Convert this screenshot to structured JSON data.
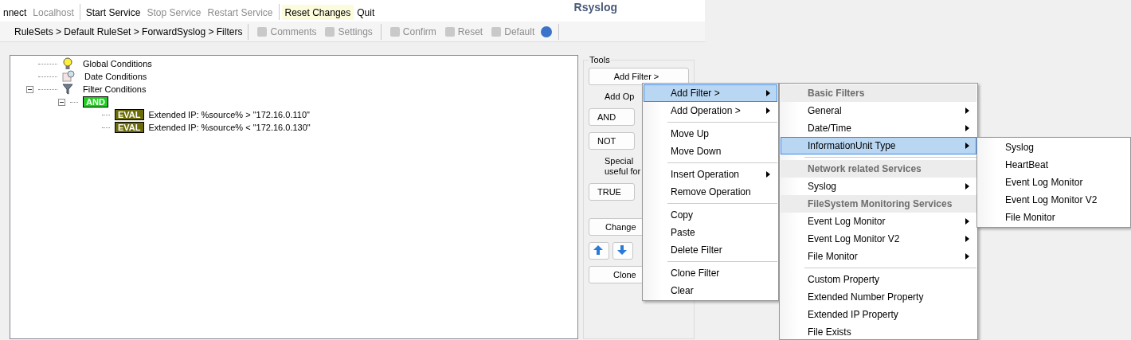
{
  "toolbar": [
    {
      "label": "nnect",
      "disabled": false
    },
    {
      "label": "Localhost",
      "disabled": true
    },
    {
      "label": "Start Service",
      "disabled": false
    },
    {
      "label": "Stop Service",
      "disabled": true
    },
    {
      "label": "Restart Service",
      "disabled": true
    },
    {
      "label": "Reset Changes",
      "disabled": false,
      "selected": true
    },
    {
      "label": "Quit",
      "disabled": false
    }
  ],
  "app_title": "Rsyslog",
  "breadcrumb": "RuleSets > Default RuleSet > ForwardSyslog > Filters",
  "actions": [
    {
      "label": "Comments",
      "disabled": true
    },
    {
      "label": "Settings",
      "disabled": true
    },
    {
      "label": "Confirm",
      "disabled": true
    },
    {
      "label": "Reset",
      "disabled": true
    },
    {
      "label": "Default",
      "disabled": true
    }
  ],
  "tree": [
    {
      "label": "Global Conditions",
      "kind": "bulb"
    },
    {
      "label": "Date Conditions",
      "kind": "calendar"
    },
    {
      "label": "Filter Conditions",
      "kind": "funnel",
      "expanded": true,
      "children": [
        {
          "label": "AND",
          "kind": "and",
          "expanded": true,
          "children": [
            {
              "label": "EVAL",
              "text": "Extended IP: %source% >  \"172.16.0.110\"",
              "kind": "eval"
            },
            {
              "label": "EVAL",
              "text": "Extended IP: %source% < \"172.16.0.130\"",
              "kind": "eval"
            }
          ]
        }
      ]
    }
  ],
  "tools": {
    "title": "Tools",
    "add_filter": "Add Filter >",
    "add_operation": "Add Op",
    "and": "AND",
    "not": "NOT",
    "special": "Special",
    "useful": "useful for",
    "true": "TRUE",
    "change": "Change",
    "clone": "Clone"
  },
  "context_menu": [
    {
      "label": "Add Filter >",
      "submenu": true,
      "selected": true
    },
    {
      "label": "Add Operation >",
      "submenu": true,
      "selected": false
    },
    {
      "kind": "separator"
    },
    {
      "label": "Move Up",
      "submenu": false,
      "selected": false
    },
    {
      "label": "Move Down",
      "submenu": false,
      "selected": false
    },
    {
      "kind": "separator"
    },
    {
      "label": "Insert Operation",
      "submenu": true,
      "selected": false
    },
    {
      "label": "Remove Operation",
      "submenu": false,
      "selected": false
    },
    {
      "kind": "separator"
    },
    {
      "label": "Copy",
      "submenu": false,
      "selected": false
    },
    {
      "label": "Paste",
      "submenu": false,
      "selected": false
    },
    {
      "label": "Delete Filter",
      "submenu": false,
      "selected": false
    },
    {
      "kind": "separator"
    },
    {
      "label": "Clone Filter",
      "submenu": false,
      "selected": false
    },
    {
      "label": "Clear",
      "submenu": false,
      "selected": false
    }
  ],
  "filter_menu": [
    {
      "kind": "header",
      "label": "Basic Filters"
    },
    {
      "label": "General",
      "submenu": true,
      "selected": false
    },
    {
      "label": "Date/Time",
      "submenu": true,
      "selected": false
    },
    {
      "label": "InformationUnit Type",
      "submenu": true,
      "selected": true
    },
    {
      "kind": "separator"
    },
    {
      "kind": "header",
      "label": "Network related Services"
    },
    {
      "label": "Syslog",
      "submenu": true,
      "selected": false
    },
    {
      "kind": "header",
      "label": "FileSystem Monitoring Services"
    },
    {
      "label": "Event Log Monitor",
      "submenu": true,
      "selected": false
    },
    {
      "label": "Event Log Monitor V2",
      "submenu": true,
      "selected": false
    },
    {
      "label": "File Monitor",
      "submenu": true,
      "selected": false
    },
    {
      "kind": "separator"
    },
    {
      "label": "Custom Property",
      "submenu": false,
      "selected": false
    },
    {
      "label": "Extended Number Property",
      "submenu": false,
      "selected": false
    },
    {
      "label": "Extended IP Property",
      "submenu": false,
      "selected": false
    },
    {
      "label": "File Exists",
      "submenu": false,
      "selected": false
    }
  ],
  "type_menu": [
    {
      "label": "Syslog",
      "selected": false
    },
    {
      "label": "HeartBeat",
      "selected": false
    },
    {
      "label": "Event Log Monitor",
      "selected": false
    },
    {
      "label": "Event Log Monitor V2",
      "selected": false
    },
    {
      "label": "File Monitor",
      "selected": false
    }
  ]
}
